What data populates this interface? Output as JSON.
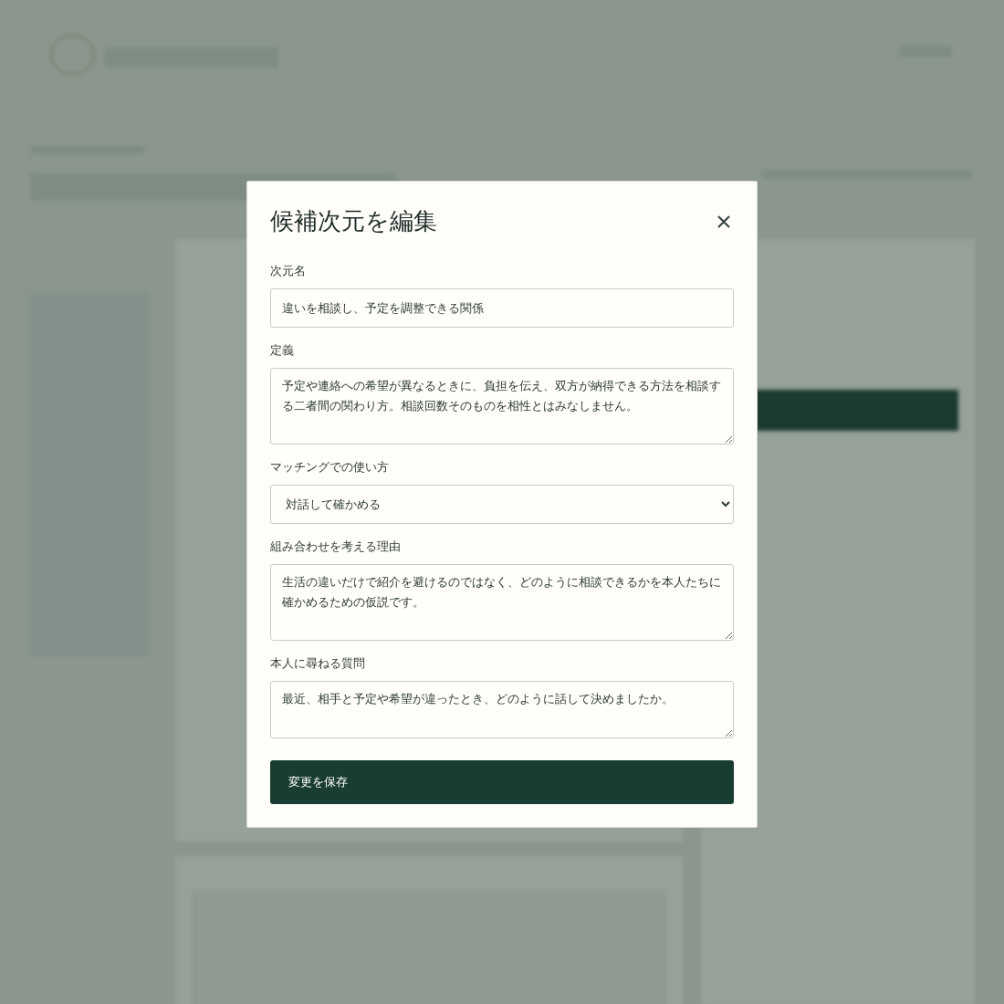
{
  "dialog": {
    "title": "候補次元を編集",
    "fields": [
      {
        "kind": "text",
        "label": "次元名",
        "value": "違いを相談し、予定を調整できる関係"
      },
      {
        "kind": "textarea",
        "label": "定義",
        "value": "予定や連絡への希望が異なるときに、負担を伝え、双方が納得できる方法を相談する二者間の関わり方。相談回数そのものを相性とはみなしません。"
      },
      {
        "kind": "select",
        "label": "マッチングでの使い方",
        "value": "対話して確かめる"
      },
      {
        "kind": "textarea",
        "label": "組み合わせを考える理由",
        "value": "生活の違いだけで紹介を避けるのではなく、どのように相談できるかを本人たちに確かめるための仮説です。"
      },
      {
        "kind": "textarea_short",
        "label": "本人に尋ねる質問",
        "value": "最近、相手と予定や希望が違ったとき、どのように話して決めましたか。"
      }
    ],
    "save_button": "変更を保存"
  }
}
